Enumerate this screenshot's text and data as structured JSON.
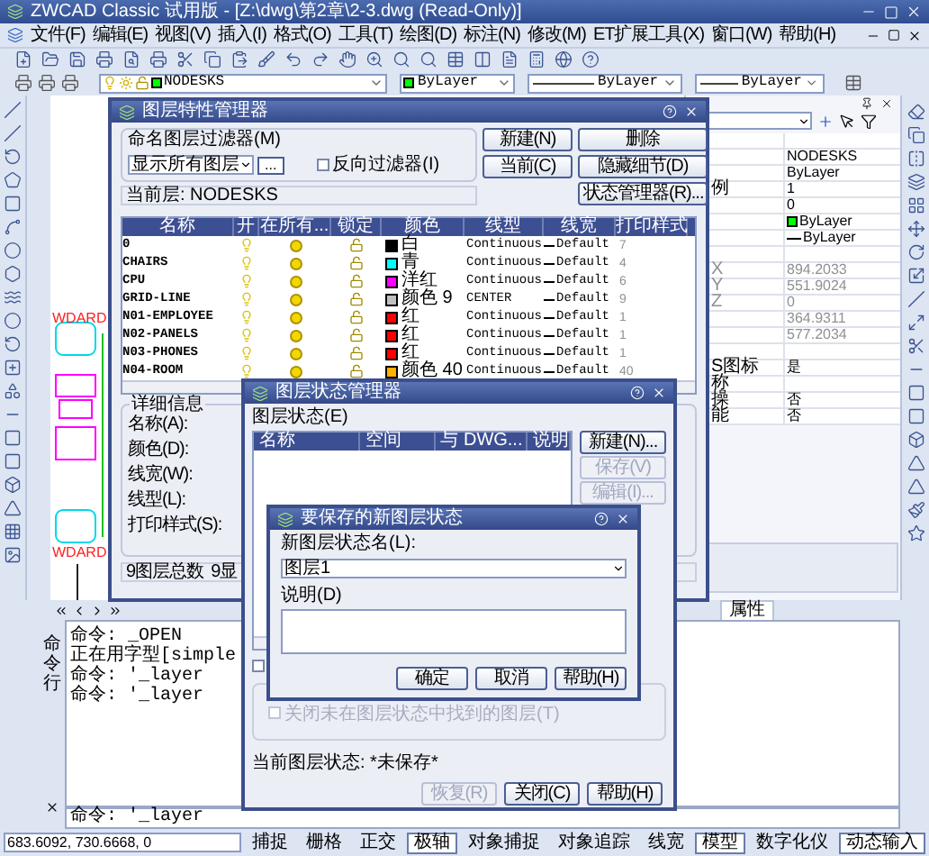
{
  "window": {
    "title": "ZWCAD Classic 试用版 - [Z:\\dwg\\第2章\\2-3.dwg (Read-Only)]"
  },
  "menu": [
    "文件(F)",
    "编辑(E)",
    "视图(V)",
    "插入(I)",
    "格式(O)",
    "工具(T)",
    "绘图(D)",
    "标注(N)",
    "修改(M)",
    "ET扩展工具(X)",
    "窗口(W)",
    "帮助(H)"
  ],
  "layer_toolbar": {
    "layer": "NODESKS",
    "color_setting": "ByLayer",
    "linetype": "ByLayer",
    "lineweight": "ByLayer"
  },
  "drawing": {
    "labels": [
      "WDARD",
      "WDARD"
    ]
  },
  "properties": {
    "rows": [
      {
        "kind": "blank"
      },
      {
        "kind": "text",
        "value": "NODESKS",
        "disabled": false
      },
      {
        "kind": "text",
        "value": "ByLayer",
        "disabled": false
      },
      {
        "kind": "text",
        "label": "例",
        "value": "1",
        "disabled": false
      },
      {
        "kind": "text",
        "value": "0",
        "disabled": false
      },
      {
        "kind": "color",
        "value": "ByLayer",
        "color": "#00ff00",
        "disabled": false
      },
      {
        "kind": "linetype",
        "value": "ByLayer",
        "disabled": false
      },
      {
        "kind": "blank"
      },
      {
        "kind": "text",
        "label": "X",
        "value": "894.2033",
        "disabled": true
      },
      {
        "kind": "text",
        "label": "Y",
        "value": "551.9024",
        "disabled": true
      },
      {
        "kind": "text",
        "label": "Z",
        "value": "0",
        "disabled": true
      },
      {
        "kind": "text",
        "value": "364.9311",
        "disabled": true
      },
      {
        "kind": "text",
        "value": "577.2034",
        "disabled": true
      },
      {
        "kind": "blank"
      },
      {
        "kind": "text",
        "label": "S图标",
        "value": "是",
        "disabled": false
      },
      {
        "kind": "text",
        "label": "称",
        "disabled": false
      },
      {
        "kind": "text",
        "label": "操",
        "value": "否",
        "disabled": false
      },
      {
        "kind": "text",
        "label": "能",
        "value": "否",
        "disabled": false
      }
    ],
    "tab": "属性"
  },
  "command_line": {
    "title": "命令行",
    "history": [
      "命令: _OPEN",
      "正在用字型[simple",
      "命令: '_layer",
      "命令: '_layer"
    ],
    "input": "命令: '_layer"
  },
  "status_bar": {
    "coordinates": "683.6092, 730.6668, 0",
    "toggles": [
      {
        "label": "捕捉",
        "on": false
      },
      {
        "label": "栅格",
        "on": false
      },
      {
        "label": "正交",
        "on": false
      },
      {
        "label": "极轴",
        "on": true
      },
      {
        "label": "对象捕捉",
        "on": false
      },
      {
        "label": "对象追踪",
        "on": false
      },
      {
        "label": "线宽",
        "on": false
      },
      {
        "label": "模型",
        "on": true
      },
      {
        "label": "数字化仪",
        "on": false
      },
      {
        "label": "动态输入",
        "on": true
      }
    ]
  },
  "layer_manager": {
    "title": "图层特性管理器",
    "filter_label": "命名图层过滤器(M)",
    "filter": "显示所有图层",
    "browse": "...",
    "invert": {
      "label": "反向过滤器(I)",
      "checked": false
    },
    "buttons": [
      "新建(N)",
      "删除",
      "当前(C)",
      "隐藏细节(D)",
      "状态管理器(R)..."
    ],
    "current_layer": "当前层: NODESKS",
    "columns": [
      "名称",
      "开",
      "在所有...",
      "锁定",
      "颜色",
      "线型",
      "线宽",
      "打印样式"
    ],
    "rows": [
      {
        "name": "0",
        "on": true,
        "frozen": false,
        "locked": false,
        "color": "#000000",
        "color_name": "白",
        "linetype": "Continuous",
        "lineweight": "Default",
        "plot_style": "7"
      },
      {
        "name": "CHAIRS",
        "on": true,
        "frozen": false,
        "locked": false,
        "color": "#00ffff",
        "color_name": "青",
        "linetype": "Continuous",
        "lineweight": "Default",
        "plot_style": "4"
      },
      {
        "name": "CPU",
        "on": true,
        "frozen": false,
        "locked": false,
        "color": "#ff00ff",
        "color_name": "洋红",
        "linetype": "Continuous",
        "lineweight": "Default",
        "plot_style": "6"
      },
      {
        "name": "GRID-LINE",
        "on": true,
        "frozen": false,
        "locked": false,
        "color": "#c0c0c0",
        "color_name": "颜色 9",
        "linetype": "CENTER",
        "lineweight": "Default",
        "plot_style": "9"
      },
      {
        "name": "N01-EMPLOYEE",
        "on": true,
        "frozen": false,
        "locked": false,
        "color": "#ff0000",
        "color_name": "红",
        "linetype": "Continuous",
        "lineweight": "Default",
        "plot_style": "1"
      },
      {
        "name": "N02-PANELS",
        "on": true,
        "frozen": false,
        "locked": false,
        "color": "#ff0000",
        "color_name": "红",
        "linetype": "Continuous",
        "lineweight": "Default",
        "plot_style": "1"
      },
      {
        "name": "N03-PHONES",
        "on": true,
        "frozen": false,
        "locked": false,
        "color": "#ff0000",
        "color_name": "红",
        "linetype": "Continuous",
        "lineweight": "Default",
        "plot_style": "1"
      },
      {
        "name": "N04-ROOM",
        "on": true,
        "frozen": false,
        "locked": false,
        "color": "#ffb000",
        "color_name": "颜色 40",
        "linetype": "Continuous",
        "lineweight": "Default",
        "plot_style": "40"
      }
    ],
    "details_title": "详细信息",
    "details": [
      "名称(A):",
      "颜色(D):",
      "线宽(W):",
      "线型(L):",
      "打印样式(S):"
    ],
    "footer": [
      "9图层总数",
      "9显"
    ]
  },
  "layer_state_manager": {
    "title": "图层状态管理器",
    "list_label": "图层状态(E)",
    "columns": [
      "名称",
      "空间",
      "与 DWG...",
      "说明"
    ],
    "side_buttons": [
      {
        "label": "新建(N)...",
        "disabled": false
      },
      {
        "label": "保存(V)",
        "disabled": true
      },
      {
        "label": "编辑(I)...",
        "disabled": true
      }
    ],
    "restore_checkbox": {
      "checked": false
    },
    "turn_off": {
      "label": "关闭未在图层状态中找到的图层(T)",
      "checked": false,
      "disabled": true
    },
    "current_state": "当前图层状态: *未保存*",
    "buttons": [
      {
        "label": "恢复(R)",
        "disabled": true
      },
      {
        "label": "关闭(C)",
        "disabled": false
      },
      {
        "label": "帮助(H)",
        "disabled": false
      }
    ]
  },
  "new_state_dialog": {
    "title": "要保存的新图层状态",
    "name_label": "新图层状态名(L):",
    "name": "图层1",
    "description_label": "说明(D)",
    "buttons": [
      "确定",
      "取消",
      "帮助(H)"
    ]
  }
}
